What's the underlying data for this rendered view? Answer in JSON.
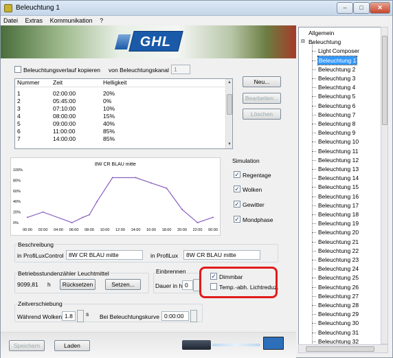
{
  "window": {
    "title": "Beleuchtung 1",
    "min": "–",
    "max": "□",
    "close": "✕"
  },
  "menu": [
    "Datei",
    "Extras",
    "Kommunikation",
    "?"
  ],
  "banner": {
    "logo": "GHL"
  },
  "copy": {
    "checkbox_label": "Beleuchtungsverlauf kopieren",
    "from_label": "von Beleuchtungskanal",
    "from_value": "1"
  },
  "table": {
    "headers": [
      "Nummer",
      "Zeit",
      "Helligkeit"
    ],
    "rows": [
      [
        "1",
        "02:00:00",
        "20%"
      ],
      [
        "2",
        "05:45:00",
        "0%"
      ],
      [
        "3",
        "07:10:00",
        "10%"
      ],
      [
        "4",
        "08:00:00",
        "15%"
      ],
      [
        "5",
        "09:00:00",
        "40%"
      ],
      [
        "6",
        "11:00:00",
        "85%"
      ],
      [
        "7",
        "14:00:00",
        "85%"
      ]
    ]
  },
  "buttons": {
    "new": "Neu...",
    "edit": "Bearbeiten...",
    "delete": "Löschen",
    "reset": "Rücksetzen",
    "set": "Setzen...",
    "save": "Speichern",
    "load": "Laden"
  },
  "chart_data": {
    "type": "line",
    "title": "8W CR BLAU mitte",
    "x": [
      "00:00",
      "02:00",
      "04:00",
      "06:00",
      "08:00",
      "10:00",
      "12:00",
      "14:00",
      "16:00",
      "18:00",
      "20:00",
      "22:00",
      "00:00"
    ],
    "x_hours": [
      0,
      2,
      5.75,
      7.17,
      8,
      9,
      11,
      14,
      16,
      18,
      20,
      22,
      24
    ],
    "y": [
      10,
      20,
      0,
      10,
      15,
      40,
      85,
      85,
      75,
      65,
      25,
      0,
      10
    ],
    "yticks": [
      "100%",
      "80%",
      "60%",
      "40%",
      "20%",
      "0%"
    ],
    "ylim": [
      0,
      100
    ],
    "grid": false
  },
  "simulation": {
    "title": "Simulation",
    "items": [
      {
        "label": "Regentage",
        "checked": true
      },
      {
        "label": "Wolken",
        "checked": true
      },
      {
        "label": "Gewitter",
        "checked": true
      },
      {
        "label": "Mondphase",
        "checked": true
      }
    ]
  },
  "description": {
    "title": "Beschreibung",
    "profilux_control_label": "in ProfiLuxControl",
    "profilux_control_value": "8W CR BLAU mitte",
    "profilux_label": "in ProfiLux",
    "profilux_value": "8W CR BLAU mitte"
  },
  "hours": {
    "title": "Betriebsstundenzähler Leuchtmittel",
    "value": "9099,81",
    "unit": "h"
  },
  "burnin": {
    "title": "Einbrennen",
    "label": "Dauer in h",
    "value": "0"
  },
  "options": {
    "dimmable": "Dimmbar",
    "dimmable_checked": true,
    "temp": "Temp.-abh. Lichtreduz.",
    "temp_checked": false
  },
  "shift": {
    "title": "Zeitverschiebung",
    "clouds_label": "Während Wolken",
    "clouds_value": "1.8",
    "clouds_unit": "s",
    "curve_label": "Bei Beleuchtungskurve",
    "curve_value": "0:00:00"
  },
  "tree": {
    "items": [
      "Allgemein",
      "Beleuchtung",
      "Light Composer",
      "Beleuchtung 1",
      "Beleuchtung 2",
      "Beleuchtung 3",
      "Beleuchtung 4",
      "Beleuchtung 5",
      "Beleuchtung 6",
      "Beleuchtung 7",
      "Beleuchtung 8",
      "Beleuchtung 9",
      "Beleuchtung 10",
      "Beleuchtung 11",
      "Beleuchtung 12",
      "Beleuchtung 13",
      "Beleuchtung 14",
      "Beleuchtung 15",
      "Beleuchtung 16",
      "Beleuchtung 17",
      "Beleuchtung 18",
      "Beleuchtung 19",
      "Beleuchtung 20",
      "Beleuchtung 21",
      "Beleuchtung 22",
      "Beleuchtung 23",
      "Beleuchtung 24",
      "Beleuchtung 25",
      "Beleuchtung 26",
      "Beleuchtung 27",
      "Beleuchtung 28",
      "Beleuchtung 29",
      "Beleuchtung 30",
      "Beleuchtung 31",
      "Beleuchtung 32"
    ],
    "selected": "Beleuchtung 1"
  },
  "colors": {
    "accent": "#3399ff",
    "highlight_box": "#e21b1b",
    "logo": "#1a5aa8",
    "line": "#8a5fbf"
  }
}
